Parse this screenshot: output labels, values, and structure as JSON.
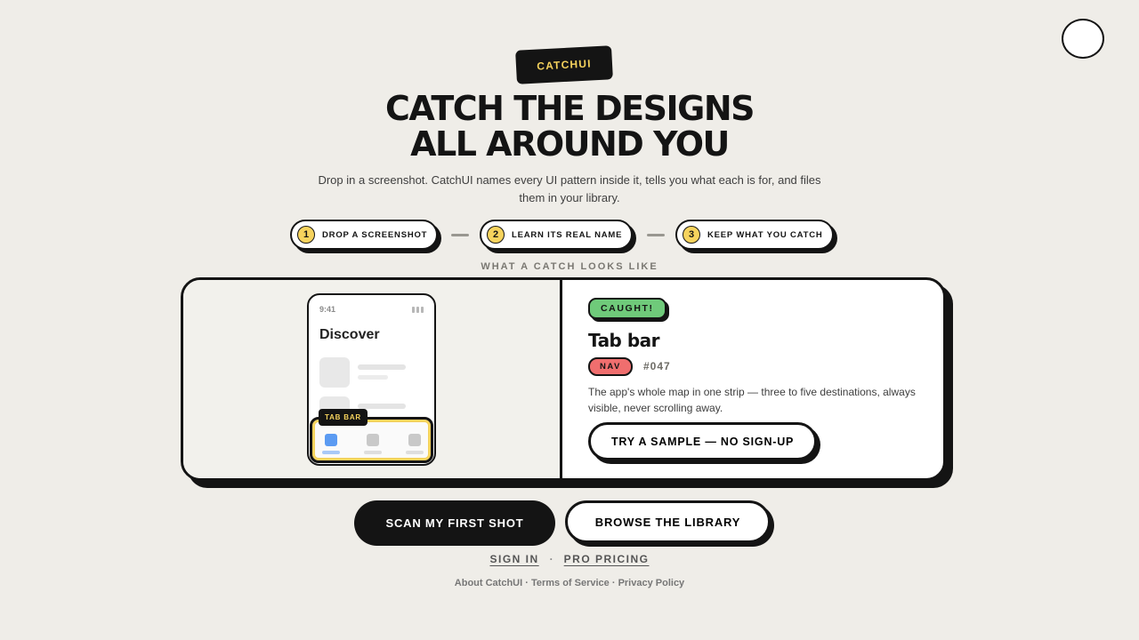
{
  "brand": {
    "label": "CATCHUI"
  },
  "hero": {
    "headline_line1": "CATCH THE DESIGNS",
    "headline_line2": "ALL AROUND YOU",
    "subtitle": "Drop in a screenshot. CatchUI names every UI pattern inside it, tells you what each is for, and files them in your library."
  },
  "steps": [
    {
      "number": "1",
      "label": "DROP A SCREENSHOT"
    },
    {
      "number": "2",
      "label": "LEARN ITS REAL NAME"
    },
    {
      "number": "3",
      "label": "KEEP WHAT YOU CATCH"
    }
  ],
  "demo": {
    "section_label": "WHAT A CATCH LOOKS LIKE",
    "phone": {
      "time": "9:41",
      "title": "Discover",
      "highlight_tag": "TAB BAR"
    },
    "result": {
      "badge": "CAUGHT!",
      "pattern_name": "Tab bar",
      "category": "NAV",
      "number": "#047",
      "description": "The app's whole map in one strip — three to five destinations, always visible, never scrolling away.",
      "sample_button": "TRY A SAMPLE — NO SIGN-UP"
    }
  },
  "cta": {
    "primary": "SCAN MY FIRST SHOT",
    "secondary": "BROWSE THE LIBRARY"
  },
  "links": {
    "sign_in": "SIGN IN",
    "separator": "·",
    "pro_pricing": "PRO PRICING"
  },
  "footer": {
    "text": "About CatchUI · Terms of Service · Privacy Policy"
  },
  "colors": {
    "background": "#efede8",
    "ink": "#141414",
    "accent_yellow": "#f6d35d",
    "caught_green": "#6fca7a",
    "nav_red": "#f06e6e",
    "active_tab_blue": "#5b9bf2"
  },
  "icons": {
    "signal": "signal-bars-icon",
    "tab": "tab-icon"
  }
}
